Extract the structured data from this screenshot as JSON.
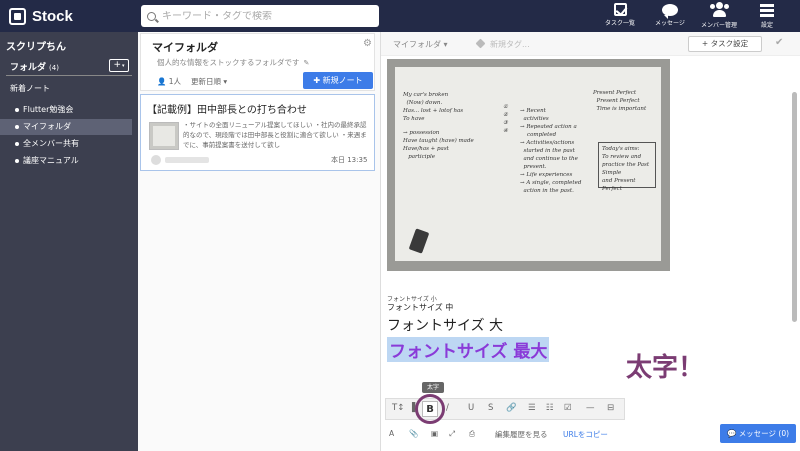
{
  "topbar": {
    "logo": "Stock",
    "search_placeholder": "キーワード・タグで検索",
    "nav": [
      {
        "label": "タスク一覧",
        "icon": "task-check-icon"
      },
      {
        "label": "メッセージ",
        "icon": "message-bubble-icon"
      },
      {
        "label": "メンバー管理",
        "icon": "members-icon"
      },
      {
        "label": "設定",
        "icon": "hamburger-menu-icon"
      }
    ]
  },
  "sidebar": {
    "user": "スクリプちん",
    "folder_label": "フォルダ",
    "folder_count": "(4)",
    "add_button": "+",
    "new_notes": "新着ノート",
    "items": [
      {
        "label": "Flutter勉強会"
      },
      {
        "label": "マイフォルダ"
      },
      {
        "label": "全メンバー共有"
      },
      {
        "label": "議座マニュアル"
      }
    ]
  },
  "list": {
    "title": "マイフォルダ",
    "description": "個人的な情報をストックするフォルダです",
    "member_count": "1人",
    "sort_label": "更新日順",
    "new_note_button": "新規ノート",
    "notes": [
      {
        "title": "【記載例】田中部長との打ち合わせ",
        "excerpt": "・サイトの全面リニューアル提案してほしい ・社内の最終承認的なので、現段階では田中部長と役割に適合て欲しい ・来週までに、事前提案書を送付して欲し",
        "date": "本日 13:35"
      }
    ]
  },
  "editor": {
    "folder": "マイフォルダ",
    "tag_placeholder": "新規タグ...",
    "task_button": "タスク設定",
    "body": {
      "small": "フォントサイズ 小",
      "medium": "フォントサイズ 中",
      "large": "フォントサイズ 大",
      "max": "フォントサイズ 最大"
    },
    "annotation": "太字！",
    "tooltip": "太字",
    "bold_button": "B",
    "toolbar_bottom": {
      "history": "編集履歴を見る",
      "url_copy": "URLをコピー",
      "message_button": "メッセージ (0)"
    }
  }
}
